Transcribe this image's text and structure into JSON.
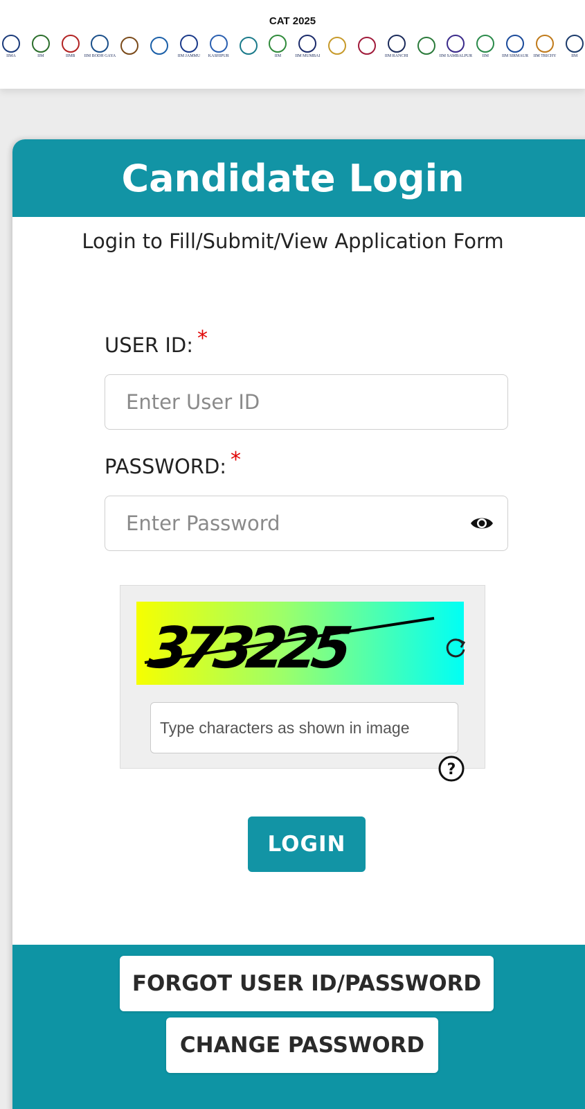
{
  "header": {
    "cat_title": "CAT 2025",
    "logos": [
      {
        "name": "iim-ahmedabad-logo",
        "caption": "IIMA"
      },
      {
        "name": "iim-amritsar-logo",
        "caption": "IIM"
      },
      {
        "name": "iim-bangalore-logo",
        "caption": "IIMB"
      },
      {
        "name": "iim-bodh-gaya-logo",
        "caption": "IIM BODH GAYA"
      },
      {
        "name": "iim-calcutta-logo",
        "caption": ""
      },
      {
        "name": "iim-indore-logo",
        "caption": ""
      },
      {
        "name": "iim-jammu-logo",
        "caption": "IIM JAMMU"
      },
      {
        "name": "iim-kashipur-logo",
        "caption": "KASHIPUR"
      },
      {
        "name": "iim-kozhikode-logo",
        "caption": ""
      },
      {
        "name": "iim-lucknow-logo",
        "caption": "IIM"
      },
      {
        "name": "iim-mumbai-logo",
        "caption": "IIM MUMBAI"
      },
      {
        "name": "iim-nagpur-logo",
        "caption": ""
      },
      {
        "name": "iim-raipur-logo",
        "caption": ""
      },
      {
        "name": "iim-ranchi-logo",
        "caption": "IIM RANCHI"
      },
      {
        "name": "iim-rohtak-logo",
        "caption": ""
      },
      {
        "name": "iim-sambalpur-logo",
        "caption": "IIM SAMBALPUR"
      },
      {
        "name": "iim-shillong-logo",
        "caption": "IIM"
      },
      {
        "name": "iim-sirmaur-logo",
        "caption": "IIM SIRMAUR"
      },
      {
        "name": "iim-trichy-logo",
        "caption": "IIM TRICHY"
      },
      {
        "name": "iim-udaipur-logo",
        "caption": "IIM"
      }
    ]
  },
  "login": {
    "title": "Candidate Login",
    "subtitle": "Login to Fill/Submit/View Application Form",
    "user_id_label": "USER ID:",
    "user_id_placeholder": "Enter User ID",
    "password_label": "PASSWORD:",
    "password_placeholder": "Enter Password",
    "required_mark": "*",
    "captcha_text": "373225",
    "captcha_placeholder": "Type characters as shown in image",
    "login_button": "LOGIN",
    "forgot_button": "FORGOT USER ID/PASSWORD",
    "change_password_button": "CHANGE PASSWORD"
  },
  "colors": {
    "accent": "#1294a5",
    "required": "#e00000"
  }
}
